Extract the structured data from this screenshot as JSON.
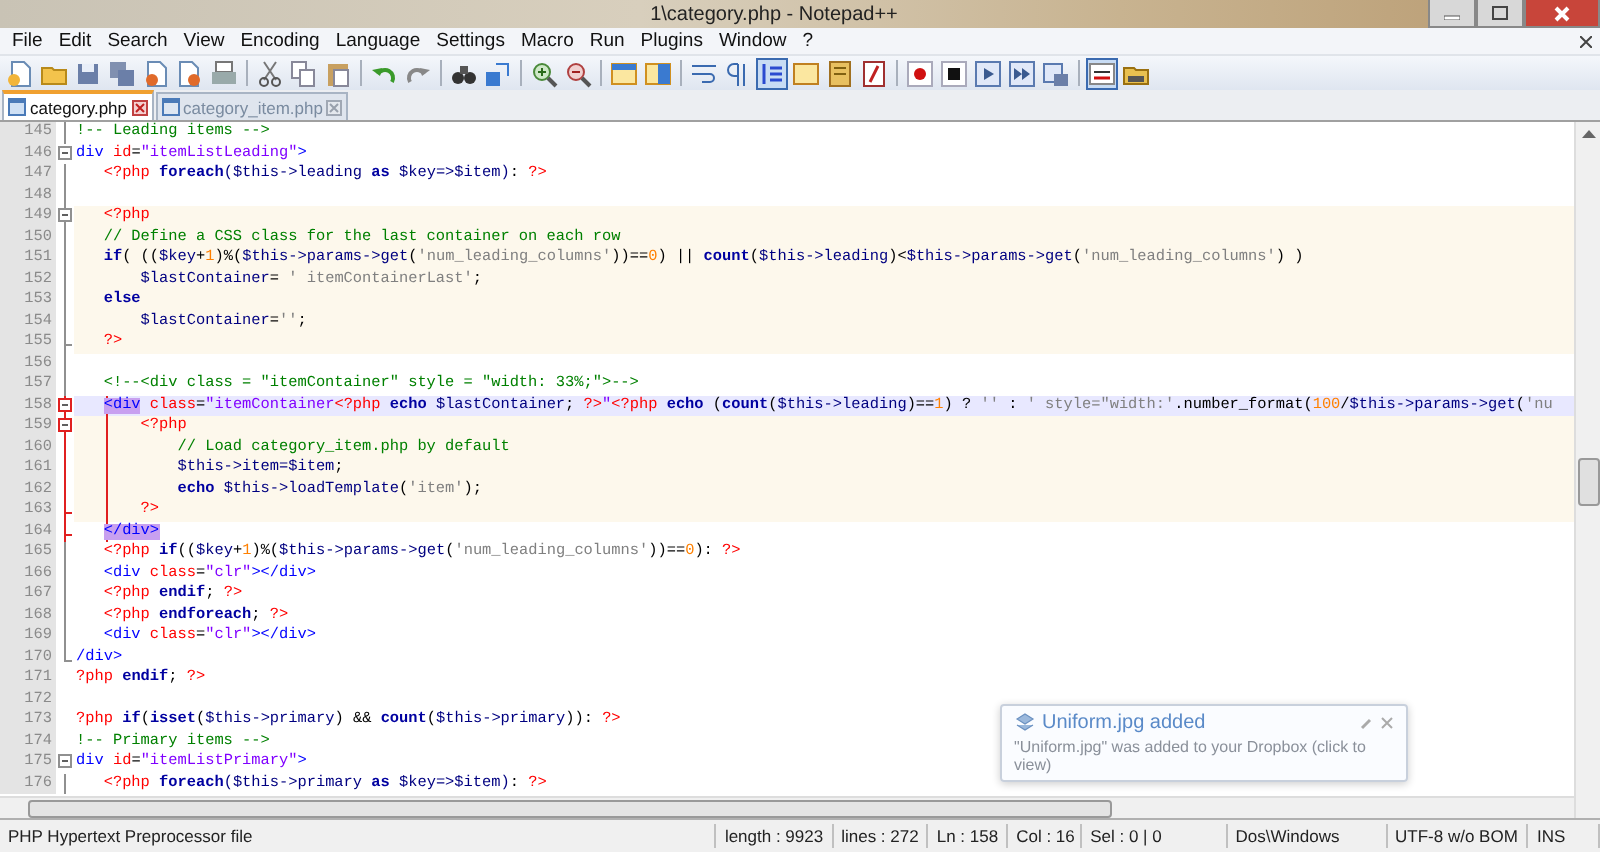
{
  "window": {
    "title": "1\\category.php - Notepad++"
  },
  "menu": [
    "File",
    "Edit",
    "Search",
    "View",
    "Encoding",
    "Language",
    "Settings",
    "Macro",
    "Run",
    "Plugins",
    "Window",
    "?"
  ],
  "toolbar_groups": [
    [
      {
        "pressed": false
      },
      {
        "pressed": false
      },
      {
        "pressed": false
      },
      {
        "pressed": false
      },
      {
        "pressed": false
      },
      {
        "pressed": false
      },
      {
        "pressed": false
      }
    ],
    [
      {
        "pressed": false
      },
      {
        "pressed": false
      },
      {
        "pressed": false
      }
    ],
    [
      {
        "pressed": false
      },
      {
        "pressed": false
      }
    ],
    [
      {
        "pressed": false
      },
      {
        "pressed": false
      }
    ],
    [
      {
        "pressed": false
      },
      {
        "pressed": false
      }
    ],
    [
      {
        "pressed": false
      },
      {
        "pressed": false
      }
    ],
    [
      {
        "pressed": false
      },
      {
        "pressed": false
      },
      {
        "pressed": true
      },
      {
        "pressed": false
      },
      {
        "pressed": false
      },
      {
        "pressed": false
      }
    ],
    [
      {
        "pressed": false
      },
      {
        "pressed": false
      },
      {
        "pressed": false
      },
      {
        "pressed": false
      },
      {
        "pressed": false
      }
    ],
    [
      {
        "pressed": true
      },
      {
        "pressed": false
      }
    ]
  ],
  "tabs": [
    {
      "label": "category.php",
      "selected": true
    },
    {
      "label": "category_item.php",
      "selected": false
    }
  ],
  "lines": [
    {
      "number": "145",
      "selected": false,
      "php_block": false,
      "in_block": false,
      "fold_open": false,
      "fold_end": false,
      "fold_guide": true,
      "tokens": [
        {
          "kind": "comment",
          "text": "!-- Leading items -->"
        }
      ]
    },
    {
      "number": "146",
      "selected": false,
      "php_block": false,
      "in_block": false,
      "fold_open": true,
      "fold_end": false,
      "fold_guide": false,
      "tokens": [
        {
          "kind": "tag",
          "text": "div"
        },
        {
          "kind": "attr",
          "text": " id"
        },
        {
          "kind": "op",
          "text": "="
        },
        {
          "kind": "str",
          "text": "\"itemListLeading\""
        },
        {
          "kind": "tag",
          "text": ">"
        }
      ]
    },
    {
      "number": "147",
      "selected": false,
      "php_block": false,
      "in_block": false,
      "fold_open": false,
      "fold_end": false,
      "fold_guide": true,
      "tokens": [
        {
          "kind": "php",
          "text": "   <?php "
        },
        {
          "kind": "kw",
          "text": "foreach"
        },
        {
          "kind": "var",
          "text": "($this->leading "
        },
        {
          "kind": "kw",
          "text": "as"
        },
        {
          "kind": "var",
          "text": " $key=>$item)"
        },
        {
          "kind": "op",
          "text": ": "
        },
        {
          "kind": "php",
          "text": "?>"
        }
      ]
    },
    {
      "number": "148",
      "selected": false,
      "php_block": false,
      "in_block": false,
      "fold_open": false,
      "fold_end": false,
      "fold_guide": true
    },
    {
      "number": "149",
      "selected": false,
      "php_block": true,
      "in_block": false,
      "fold_open": true,
      "fold_end": false,
      "fold_guide": true,
      "tokens": [
        {
          "kind": "php",
          "text": "   <?php"
        }
      ]
    },
    {
      "number": "150",
      "selected": false,
      "php_block": true,
      "in_block": false,
      "fold_open": false,
      "fold_end": false,
      "fold_guide": true,
      "tokens": [
        {
          "kind": "comment",
          "text": "   // Define a CSS class for the last container on each row"
        }
      ]
    },
    {
      "number": "151",
      "selected": false,
      "php_block": true,
      "in_block": false,
      "fold_open": false,
      "fold_end": false,
      "fold_guide": true,
      "tokens": [
        {
          "kind": "kw",
          "text": "   if"
        },
        {
          "kind": "op",
          "text": "( (("
        },
        {
          "kind": "var",
          "text": "$key"
        },
        {
          "kind": "op",
          "text": "+"
        },
        {
          "kind": "num",
          "text": "1"
        },
        {
          "kind": "op",
          "text": ")%("
        },
        {
          "kind": "var",
          "text": "$this->params->get"
        },
        {
          "kind": "op",
          "text": "("
        },
        {
          "kind": "sq",
          "text": "'num_leading_columns'"
        },
        {
          "kind": "op",
          "text": "))=="
        },
        {
          "kind": "num",
          "text": "0"
        },
        {
          "kind": "op",
          "text": ") || "
        },
        {
          "kind": "kw",
          "text": "count"
        },
        {
          "kind": "op",
          "text": "("
        },
        {
          "kind": "var",
          "text": "$this->leading"
        },
        {
          "kind": "op",
          "text": ")<"
        },
        {
          "kind": "var",
          "text": "$this->params->get"
        },
        {
          "kind": "op",
          "text": "("
        },
        {
          "kind": "sq",
          "text": "'num_leading_columns'"
        },
        {
          "kind": "op",
          "text": ") )"
        }
      ]
    },
    {
      "number": "152",
      "selected": false,
      "php_block": true,
      "in_block": false,
      "fold_open": false,
      "fold_end": false,
      "fold_guide": true,
      "tokens": [
        {
          "kind": "var",
          "text": "       $lastContainer"
        },
        {
          "kind": "op",
          "text": "= "
        },
        {
          "kind": "sq",
          "text": "' itemContainerLast'"
        },
        {
          "kind": "op",
          "text": ";"
        }
      ]
    },
    {
      "number": "153",
      "selected": false,
      "php_block": true,
      "in_block": false,
      "fold_open": false,
      "fold_end": false,
      "fold_guide": true,
      "tokens": [
        {
          "kind": "kw",
          "text": "   else"
        }
      ]
    },
    {
      "number": "154",
      "selected": false,
      "php_block": true,
      "in_block": false,
      "fold_open": false,
      "fold_end": false,
      "fold_guide": true,
      "tokens": [
        {
          "kind": "var",
          "text": "       $lastContainer"
        },
        {
          "kind": "op",
          "text": "="
        },
        {
          "kind": "sq",
          "text": "''"
        },
        {
          "kind": "op",
          "text": ";"
        }
      ]
    },
    {
      "number": "155",
      "selected": false,
      "php_block": true,
      "in_block": false,
      "fold_open": false,
      "fold_end": true,
      "fold_guide": true,
      "tokens": [
        {
          "kind": "php",
          "text": "   ?>"
        }
      ]
    },
    {
      "number": "156",
      "selected": false,
      "php_block": false,
      "in_block": false,
      "fold_open": false,
      "fold_end": false,
      "fold_guide": true
    },
    {
      "number": "157",
      "selected": false,
      "php_block": false,
      "in_block": false,
      "fold_open": false,
      "fold_end": false,
      "fold_guide": true,
      "tokens": [
        {
          "kind": "comment",
          "text": "   <!--<div class = \"itemContainer\" style = \"width: 33%;\">-->"
        }
      ]
    },
    {
      "number": "158",
      "selected": true,
      "php_block": false,
      "in_block": true,
      "fold_open": true,
      "fold_end": false,
      "fold_guide": true,
      "tokens": [
        {
          "kind": "match",
          "text": "   <div"
        },
        {
          "kind": "attr",
          "text": " class"
        },
        {
          "kind": "op",
          "text": "="
        },
        {
          "kind": "str",
          "text": "\"itemContainer"
        },
        {
          "kind": "php",
          "text": "<?php "
        },
        {
          "kind": "kw",
          "text": "echo"
        },
        {
          "kind": "var",
          "text": " $lastContainer"
        },
        {
          "kind": "op",
          "text": "; "
        },
        {
          "kind": "php",
          "text": "?>"
        },
        {
          "kind": "str",
          "text": "\""
        },
        {
          "kind": "php",
          "text": "<?php "
        },
        {
          "kind": "kw",
          "text": "echo"
        },
        {
          "kind": "op",
          "text": " ("
        },
        {
          "kind": "kw",
          "text": "count"
        },
        {
          "kind": "op",
          "text": "("
        },
        {
          "kind": "var",
          "text": "$this->leading"
        },
        {
          "kind": "op",
          "text": ")=="
        },
        {
          "kind": "num",
          "text": "1"
        },
        {
          "kind": "op",
          "text": ") ? "
        },
        {
          "kind": "sq",
          "text": "''"
        },
        {
          "kind": "op",
          "text": " : "
        },
        {
          "kind": "sq",
          "text": "' style=\"width:'"
        },
        {
          "kind": "op",
          "text": ".number_format("
        },
        {
          "kind": "num",
          "text": "100"
        },
        {
          "kind": "op",
          "text": "/"
        },
        {
          "kind": "var",
          "text": "$this->params->get"
        },
        {
          "kind": "op",
          "text": "("
        },
        {
          "kind": "sq",
          "text": "'nu"
        }
      ]
    },
    {
      "number": "159",
      "selected": false,
      "php_block": true,
      "in_block": true,
      "fold_open": true,
      "fold_end": false,
      "fold_guide": true,
      "tokens": [
        {
          "kind": "php",
          "text": "       <?php"
        }
      ]
    },
    {
      "number": "160",
      "selected": false,
      "php_block": true,
      "in_block": true,
      "fold_open": false,
      "fold_end": false,
      "fold_guide": true,
      "tokens": [
        {
          "kind": "comment",
          "text": "           // Load category_item.php by default"
        }
      ]
    },
    {
      "number": "161",
      "selected": false,
      "php_block": true,
      "in_block": true,
      "fold_open": false,
      "fold_end": false,
      "fold_guide": true,
      "tokens": [
        {
          "kind": "var",
          "text": "           $this->item=$item"
        },
        {
          "kind": "op",
          "text": ";"
        }
      ]
    },
    {
      "number": "162",
      "selected": false,
      "php_block": true,
      "in_block": true,
      "fold_open": false,
      "fold_end": false,
      "fold_guide": true,
      "tokens": [
        {
          "kind": "kw",
          "text": "           echo"
        },
        {
          "kind": "var",
          "text": " $this->loadTemplate"
        },
        {
          "kind": "op",
          "text": "("
        },
        {
          "kind": "sq",
          "text": "'item'"
        },
        {
          "kind": "op",
          "text": ");"
        }
      ]
    },
    {
      "number": "163",
      "selected": false,
      "php_block": true,
      "in_block": true,
      "fold_open": false,
      "fold_end": true,
      "fold_guide": true,
      "tokens": [
        {
          "kind": "php",
          "text": "       ?>"
        }
      ]
    },
    {
      "number": "164",
      "selected": false,
      "php_block": false,
      "in_block": true,
      "fold_open": false,
      "fold_end": true,
      "fold_guide": true,
      "tokens": [
        {
          "kind": "match",
          "text": "   </div>"
        }
      ]
    },
    {
      "number": "165",
      "selected": false,
      "php_block": false,
      "in_block": false,
      "fold_open": false,
      "fold_end": false,
      "fold_guide": true,
      "tokens": [
        {
          "kind": "php",
          "text": "   <?php "
        },
        {
          "kind": "kw",
          "text": "if"
        },
        {
          "kind": "op",
          "text": "(("
        },
        {
          "kind": "var",
          "text": "$key"
        },
        {
          "kind": "op",
          "text": "+"
        },
        {
          "kind": "num",
          "text": "1"
        },
        {
          "kind": "op",
          "text": ")%("
        },
        {
          "kind": "var",
          "text": "$this->params->get"
        },
        {
          "kind": "op",
          "text": "("
        },
        {
          "kind": "sq",
          "text": "'num_leading_columns'"
        },
        {
          "kind": "op",
          "text": "))=="
        },
        {
          "kind": "num",
          "text": "0"
        },
        {
          "kind": "op",
          "text": "): "
        },
        {
          "kind": "php",
          "text": "?>"
        }
      ]
    },
    {
      "number": "166",
      "selected": false,
      "php_block": false,
      "in_block": false,
      "fold_open": false,
      "fold_end": false,
      "fold_guide": true,
      "tokens": [
        {
          "kind": "tag",
          "text": "   <div"
        },
        {
          "kind": "attr",
          "text": " class"
        },
        {
          "kind": "op",
          "text": "="
        },
        {
          "kind": "str",
          "text": "\"clr\""
        },
        {
          "kind": "tag",
          "text": "></div>"
        }
      ]
    },
    {
      "number": "167",
      "selected": false,
      "php_block": false,
      "in_block": false,
      "fold_open": false,
      "fold_end": false,
      "fold_guide": true,
      "tokens": [
        {
          "kind": "php",
          "text": "   <?php "
        },
        {
          "kind": "kw",
          "text": "endif"
        },
        {
          "kind": "op",
          "text": "; "
        },
        {
          "kind": "php",
          "text": "?>"
        }
      ]
    },
    {
      "number": "168",
      "selected": false,
      "php_block": false,
      "in_block": false,
      "fold_open": false,
      "fold_end": false,
      "fold_guide": true,
      "tokens": [
        {
          "kind": "php",
          "text": "   <?php "
        },
        {
          "kind": "kw",
          "text": "endforeach"
        },
        {
          "kind": "op",
          "text": "; "
        },
        {
          "kind": "php",
          "text": "?>"
        }
      ]
    },
    {
      "number": "169",
      "selected": false,
      "php_block": false,
      "in_block": false,
      "fold_open": false,
      "fold_end": false,
      "fold_guide": true,
      "tokens": [
        {
          "kind": "tag",
          "text": "   <div"
        },
        {
          "kind": "attr",
          "text": " class"
        },
        {
          "kind": "op",
          "text": "="
        },
        {
          "kind": "str",
          "text": "\"clr\""
        },
        {
          "kind": "tag",
          "text": "></div>"
        }
      ]
    },
    {
      "number": "170",
      "selected": false,
      "php_block": false,
      "in_block": false,
      "fold_open": false,
      "fold_end": true,
      "fold_guide": false,
      "tokens": [
        {
          "kind": "tag",
          "text": "/div>"
        }
      ]
    },
    {
      "number": "171",
      "selected": false,
      "php_block": false,
      "in_block": false,
      "fold_open": false,
      "fold_end": false,
      "fold_guide": false,
      "tokens": [
        {
          "kind": "php",
          "text": "?php "
        },
        {
          "kind": "kw",
          "text": "endif"
        },
        {
          "kind": "op",
          "text": "; "
        },
        {
          "kind": "php",
          "text": "?>"
        }
      ]
    },
    {
      "number": "172",
      "selected": false,
      "php_block": false,
      "in_block": false,
      "fold_open": false,
      "fold_end": false,
      "fold_guide": false
    },
    {
      "number": "173",
      "selected": false,
      "php_block": false,
      "in_block": false,
      "fold_open": false,
      "fold_end": false,
      "fold_guide": false,
      "tokens": [
        {
          "kind": "php",
          "text": "?php "
        },
        {
          "kind": "kw",
          "text": "if"
        },
        {
          "kind": "op",
          "text": "("
        },
        {
          "kind": "kw",
          "text": "isset"
        },
        {
          "kind": "op",
          "text": "("
        },
        {
          "kind": "var",
          "text": "$this->primary"
        },
        {
          "kind": "op",
          "text": ") && "
        },
        {
          "kind": "kw",
          "text": "count"
        },
        {
          "kind": "op",
          "text": "("
        },
        {
          "kind": "var",
          "text": "$this->primary"
        },
        {
          "kind": "op",
          "text": ")): "
        },
        {
          "kind": "php",
          "text": "?>"
        }
      ]
    },
    {
      "number": "174",
      "selected": false,
      "php_block": false,
      "in_block": false,
      "fold_open": false,
      "fold_end": false,
      "fold_guide": false,
      "tokens": [
        {
          "kind": "comment",
          "text": "!-- Primary items -->"
        }
      ]
    },
    {
      "number": "175",
      "selected": false,
      "php_block": false,
      "in_block": false,
      "fold_open": true,
      "fold_end": false,
      "fold_guide": false,
      "tokens": [
        {
          "kind": "tag",
          "text": "div"
        },
        {
          "kind": "attr",
          "text": " id"
        },
        {
          "kind": "op",
          "text": "="
        },
        {
          "kind": "str",
          "text": "\"itemListPrimary\""
        },
        {
          "kind": "tag",
          "text": ">"
        }
      ]
    },
    {
      "number": "176",
      "selected": false,
      "php_block": false,
      "in_block": false,
      "fold_open": false,
      "fold_end": false,
      "fold_guide": true,
      "tokens": [
        {
          "kind": "php",
          "text": "   <?php "
        },
        {
          "kind": "kw",
          "text": "foreach"
        },
        {
          "kind": "var",
          "text": "($this->primary "
        },
        {
          "kind": "kw",
          "text": "as"
        },
        {
          "kind": "var",
          "text": " $key=>$item)"
        },
        {
          "kind": "op",
          "text": ": "
        },
        {
          "kind": "php",
          "text": "?>"
        }
      ]
    }
  ],
  "notification": {
    "title": "Uniform.jpg added",
    "message": "\"Uniform.jpg\" was added to your Dropbox (click to view)"
  },
  "status_bar": {
    "file_type": "PHP Hypertext Preprocessor file",
    "length": "length : 9923",
    "lines": "lines : 272",
    "ln": "Ln : 158",
    "col": "Col : 16",
    "sel": "Sel : 0 | 0",
    "eol": "Dos\\Windows",
    "encoding": "UTF-8 w/o BOM",
    "mode": "INS"
  }
}
